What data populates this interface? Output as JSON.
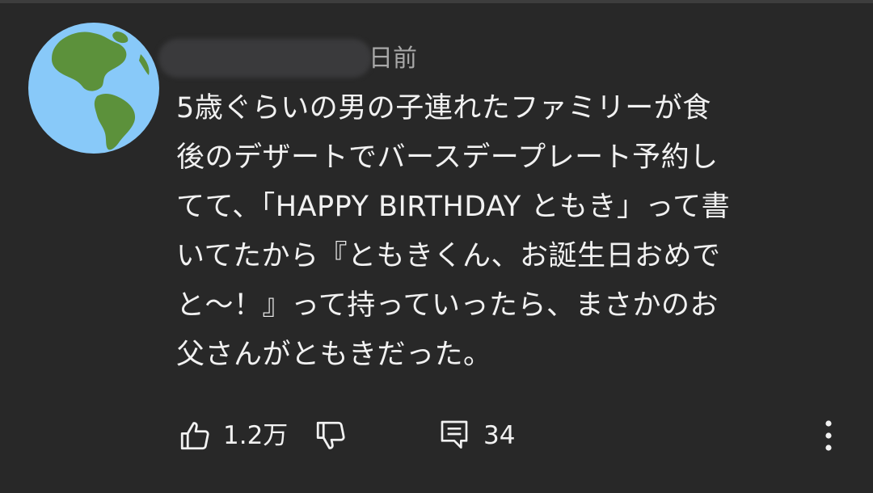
{
  "comment": {
    "timestamp": "日前",
    "lines": [
      "5歳ぐらいの男の子連れたファミリーが食",
      "後のデザートでバースデープレート予約し",
      "てて、「HAPPY BIRTHDAY ともき」って書",
      "いてたから『ともきくん、お誕生日おめで",
      "と〜！』って持っていったら、まさかのお",
      "父さんがともきだった。"
    ]
  },
  "actions": {
    "like_count": "1.2万",
    "reply_count": "34"
  },
  "icons": {
    "avatar": "globe-americas-icon",
    "like": "thumbs-up-icon",
    "dislike": "thumbs-down-icon",
    "reply": "comment-icon",
    "more": "more-vert-icon"
  },
  "colors": {
    "background": "#282828",
    "text": "#f1f1f1",
    "secondary_text": "#a8a8a8",
    "globe_ocean": "#88c9f9",
    "globe_land": "#5c913b"
  }
}
